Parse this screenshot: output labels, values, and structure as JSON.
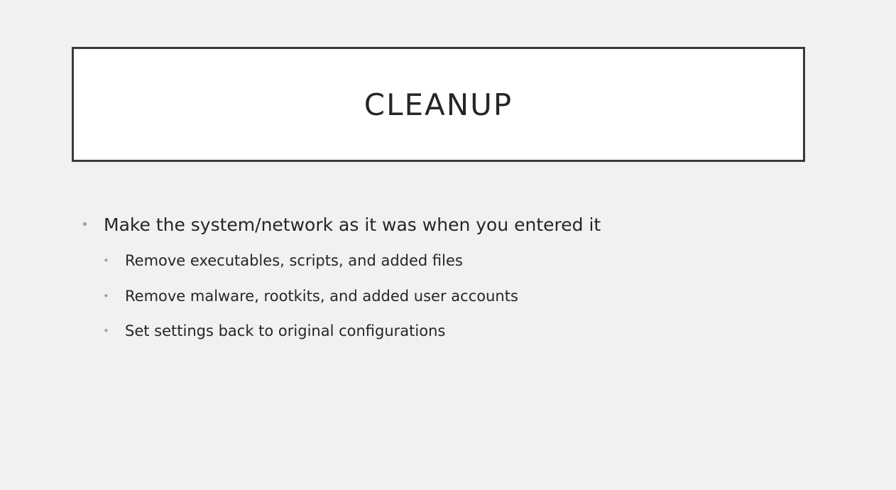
{
  "slide": {
    "title": "CLEANUP",
    "bullets": [
      {
        "text": "Make the system/network as it was when you entered it",
        "subbullets": [
          "Remove executables, scripts, and added files",
          "Remove malware, rootkits, and added user accounts",
          "Set settings back to original configurations"
        ]
      }
    ],
    "bullet_glyph": "•"
  }
}
